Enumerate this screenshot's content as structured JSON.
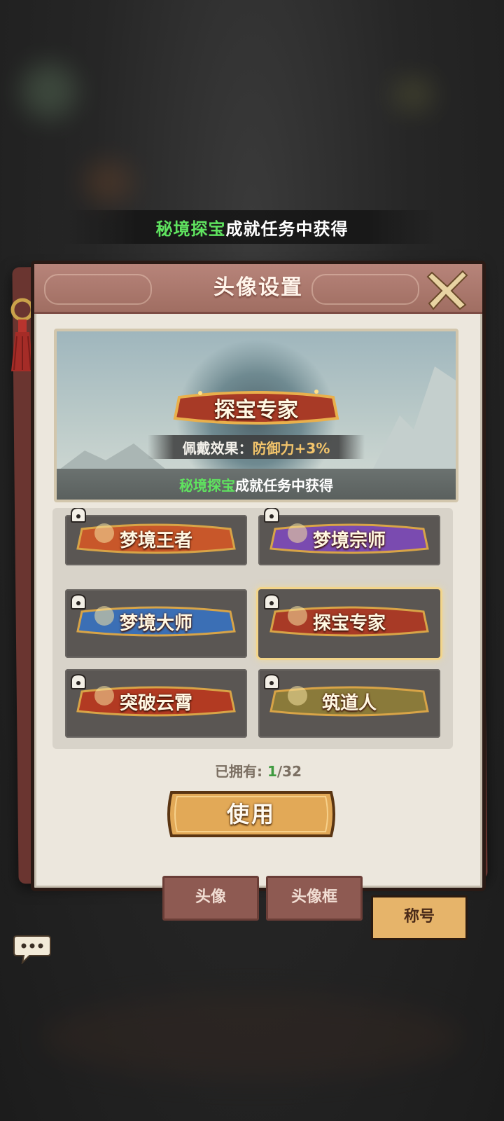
{
  "toast": {
    "highlight": "秘境探宝",
    "text": "成就任务中获得"
  },
  "panel": {
    "title": "头像设置"
  },
  "preview": {
    "badge": "探宝专家",
    "effect_label": "佩戴效果：",
    "effect_value": "防御力+3%",
    "source_highlight": "秘境探宝",
    "source_text": "成就任务中获得"
  },
  "titles": [
    {
      "name": "梦境王者",
      "locked": true,
      "selected": false,
      "color": "#c8572a"
    },
    {
      "name": "梦境宗师",
      "locked": true,
      "selected": false,
      "color": "#7a4bb0"
    },
    {
      "name": "梦境大师",
      "locked": true,
      "selected": false,
      "color": "#3b6fb5"
    },
    {
      "name": "探宝专家",
      "locked": true,
      "selected": true,
      "color": "#a83a26"
    },
    {
      "name": "突破云霄",
      "locked": true,
      "selected": false,
      "color": "#b23a22"
    },
    {
      "name": "筑道人",
      "locked": true,
      "selected": false,
      "color": "#8a7a3a"
    }
  ],
  "owned": {
    "label": "已拥有: ",
    "count": "1",
    "total": "/32"
  },
  "use_button": {
    "label": "使用"
  },
  "tabs": [
    {
      "label": "头像",
      "active": false
    },
    {
      "label": "头像框",
      "active": false
    },
    {
      "label": "称号",
      "active": true
    }
  ],
  "icons": {
    "close": "close-x-icon",
    "lock": "lock-icon",
    "chat": "chat-bubble-icon"
  }
}
